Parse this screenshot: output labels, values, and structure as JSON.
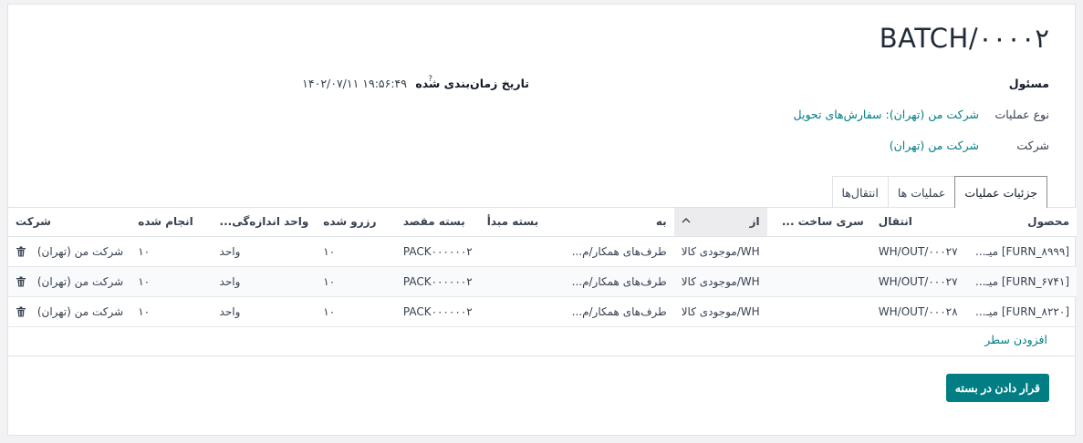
{
  "header": {
    "title": "BATCH/۰۰۰۰۲"
  },
  "fields": {
    "responsible_label": "مسئول",
    "operation_type_label": "نوع عملیات",
    "operation_type_value": "شرکت من (تهران): سفارش‌های تحویل",
    "company_label": "شرکت",
    "company_value": "شرکت من (تهران)",
    "scheduled_date_label": "تاریخ زمان‌بندی شده",
    "scheduled_date_help": "?",
    "scheduled_date_value": "۱۴۰۲/۰۷/۱۱ ۱۹:۵۶:۴۹"
  },
  "tabs": [
    {
      "label": "جزئیات عملیات",
      "active": true
    },
    {
      "label": "عملیات ها",
      "active": false
    },
    {
      "label": "انتقال‌ها",
      "active": false
    }
  ],
  "table": {
    "columns": {
      "product": "محصول",
      "transfer": "انتقال",
      "lot": "سری ساخت ...",
      "from": "از",
      "to": "به",
      "source_pkg": "بسته مبدأ",
      "dest_pkg": "بسته مقصد",
      "reserved": "رزرو شده",
      "uom": "واحد اندازه‌گی...",
      "done": "انجام شده",
      "company": "شرکت"
    },
    "rows": [
      {
        "product": "[FURN_۸۹۹۹] میـ...",
        "transfer": "WH/OUT/۰۰۰۲۷",
        "lot": "",
        "from": "WH/موجودی کالا",
        "to": "طرف‌های همکار/م...",
        "source_pkg": "",
        "dest_pkg": "PACK۰۰۰۰۰۰۲",
        "reserved": "۱۰",
        "uom": "واحد",
        "done": "۱۰",
        "company": "شرکت من (تهران)"
      },
      {
        "product": "[FURN_۶۷۴۱] میـ...",
        "transfer": "WH/OUT/۰۰۰۲۷",
        "lot": "",
        "from": "WH/موجودی کالا",
        "to": "طرف‌های همکار/م...",
        "source_pkg": "",
        "dest_pkg": "PACK۰۰۰۰۰۰۲",
        "reserved": "۱۰",
        "uom": "واحد",
        "done": "۱۰",
        "company": "شرکت من (تهران)"
      },
      {
        "product": "[FURN_۸۲۲۰] میـ...",
        "transfer": "WH/OUT/۰۰۰۲۸",
        "lot": "",
        "from": "WH/موجودی کالا",
        "to": "طرف‌های همکار/م...",
        "source_pkg": "",
        "dest_pkg": "PACK۰۰۰۰۰۰۲",
        "reserved": "۱۰",
        "uom": "واحد",
        "done": "۱۰",
        "company": "شرکت من (تهران)"
      }
    ],
    "add_line": "افزودن سطر"
  },
  "actions": {
    "put_in_pack": "قرار دادن در بسته"
  },
  "colors": {
    "accent": "#017e84"
  }
}
